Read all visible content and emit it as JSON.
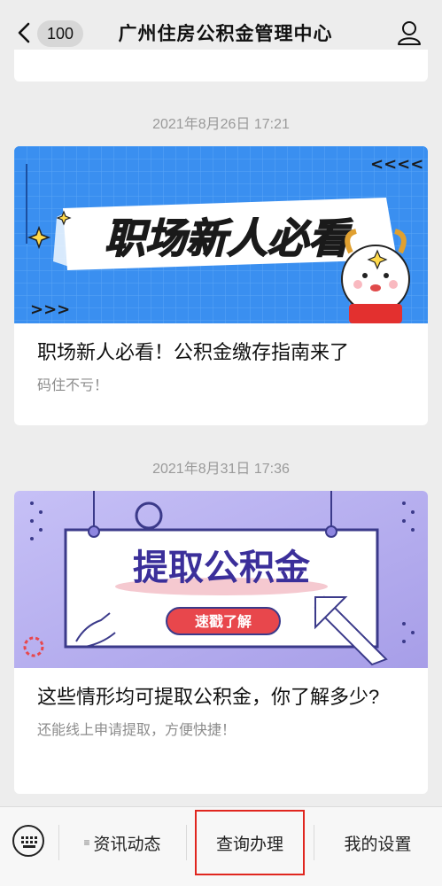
{
  "nav": {
    "unread_count": "100",
    "title": "广州住房公积金管理中心"
  },
  "feed": [
    {
      "timestamp": "2021年8月26日 17:21",
      "cover_text": "职场新人必看",
      "title": "职场新人必看！公积金缴存指南来了",
      "digest": "码住不亏！"
    },
    {
      "timestamp": "2021年8月31日 17:36",
      "cover_text": "提取公积金",
      "cover_button": "速戳了解",
      "title": "这些情形均可提取公积金，你了解多少?",
      "digest": "还能线上申请提取，方便快捷！"
    }
  ],
  "menu": {
    "items": [
      {
        "label": "资讯动态",
        "has_submenu": true
      },
      {
        "label": "查询办理",
        "has_submenu": false,
        "highlighted": true
      },
      {
        "label": "我的设置",
        "has_submenu": false
      }
    ]
  },
  "colors": {
    "highlight": "#e0261f",
    "cover1_bg": "#3a8ff0",
    "cover2_bg": "#b9b1f0"
  }
}
